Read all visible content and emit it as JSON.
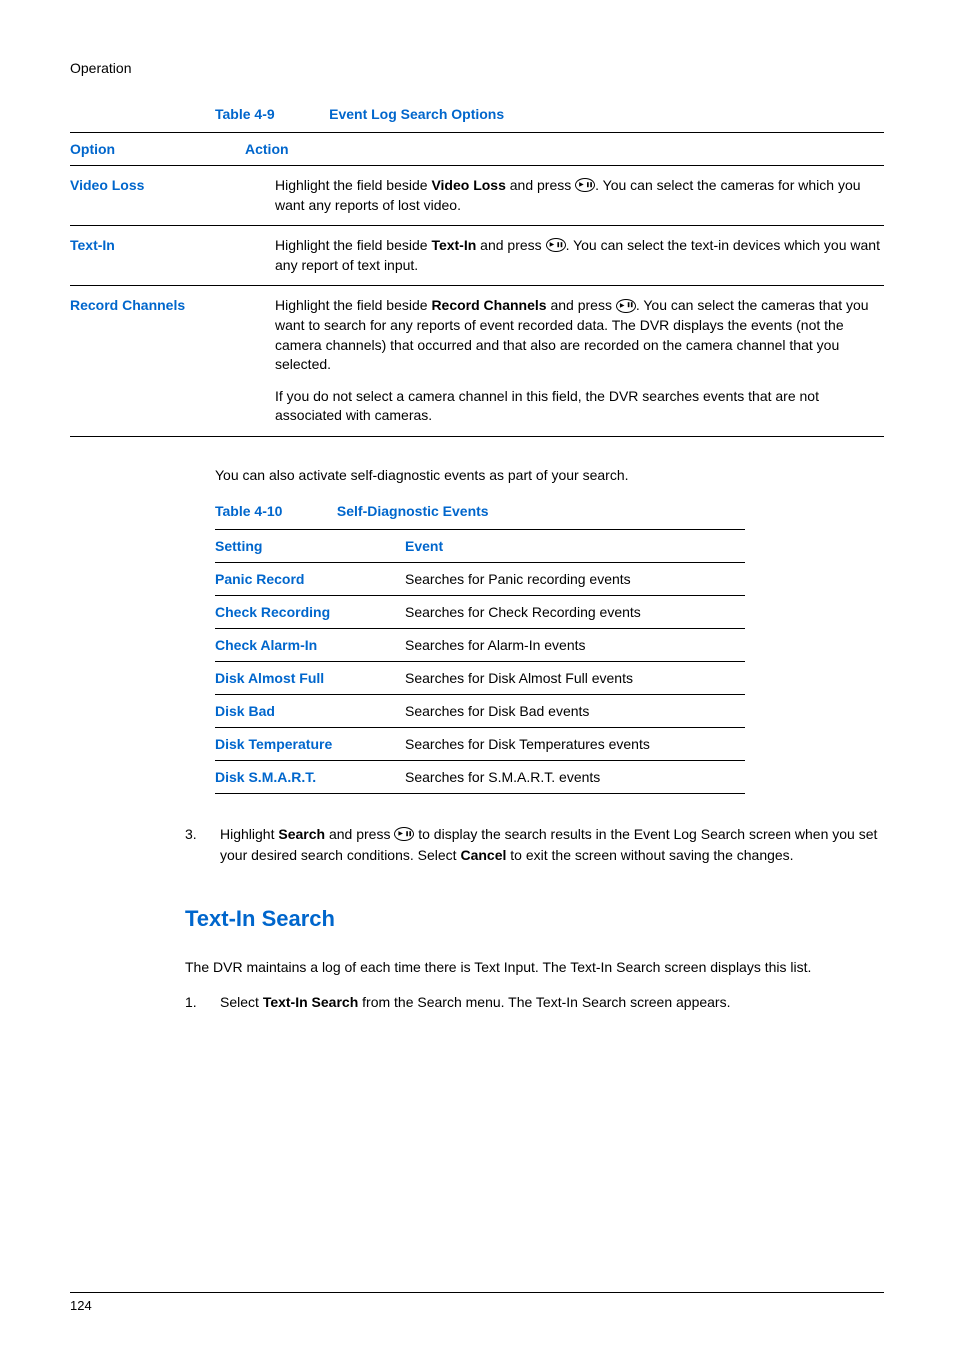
{
  "header": "Operation",
  "table1": {
    "caption_num": "Table 4-9",
    "caption_title": "Event Log Search Options",
    "headers": {
      "col1": "Option",
      "col2": "Action"
    },
    "rows": [
      {
        "option": "Video Loss",
        "action_before_bold": "Highlight the field beside ",
        "action_bold": "Video Loss",
        "action_after_bold": " and press ",
        "action_tail": ". You can select the cameras for which you want any reports of lost video."
      },
      {
        "option": "Text-In",
        "action_before_bold": "Highlight the field beside ",
        "action_bold": "Text-In",
        "action_after_bold": " and press ",
        "action_tail": ". You can select the text-in devices which you want any report of text input."
      },
      {
        "option": "Record Channels",
        "action_before_bold": "Highlight the field beside ",
        "action_bold": "Record Channels",
        "action_after_bold": " and press ",
        "action_tail": ". You can select the cameras that you want to search for any reports of event recorded data. The DVR displays the events (not the camera channels) that occurred and that also are recorded on the camera channel that you selected.",
        "action_p2": "If you do not select a camera channel in this field, the DVR searches events that are not associated with cameras."
      }
    ]
  },
  "mid_para": "You can also activate self-diagnostic events as part of your search.",
  "table2": {
    "caption_num": "Table 4-10",
    "caption_title": "Self-Diagnostic Events",
    "headers": {
      "col1": "Setting",
      "col2": "Event"
    },
    "rows": [
      {
        "setting": "Panic Record",
        "event": "Searches for Panic recording events"
      },
      {
        "setting": "Check Recording",
        "event": "Searches for Check Recording events"
      },
      {
        "setting": "Check Alarm-In",
        "event": "Searches for Alarm-In events"
      },
      {
        "setting": "Disk Almost Full",
        "event": "Searches for Disk Almost Full events"
      },
      {
        "setting": "Disk Bad",
        "event": "Searches for Disk Bad events"
      },
      {
        "setting": "Disk Temperature",
        "event": "Searches for Disk Temperatures events"
      },
      {
        "setting": "Disk S.M.A.R.T.",
        "event": "Searches for S.M.A.R.T. events"
      }
    ]
  },
  "step3": {
    "num": "3.",
    "pre": "Highlight ",
    "bold1": "Search",
    "mid1": " and press ",
    "mid2": " to display the search results in the Event Log Search screen when you set your desired search conditions. Select ",
    "bold2": "Cancel",
    "tail": " to exit the screen without saving the changes."
  },
  "section_heading": "Text-In Search",
  "para1": "The DVR maintains a log of each time there is Text Input. The Text-In Search screen displays this list.",
  "step1": {
    "num": "1.",
    "pre": "Select ",
    "bold": "Text-In Search",
    "tail": " from the Search menu. The Text-In Search screen appears."
  },
  "page_num": "124"
}
